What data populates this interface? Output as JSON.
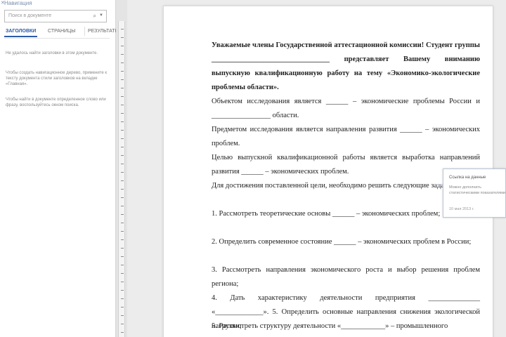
{
  "nav_pane": {
    "title": "Навигация",
    "search_placeholder": "Поиск в документе",
    "tabs": [
      {
        "label": "ЗАГОЛОВКИ",
        "active": true
      },
      {
        "label": "СТРАНИЦЫ",
        "active": false
      },
      {
        "label": "РЕЗУЛЬТАТЫ",
        "active": false
      }
    ],
    "help": [
      "Не удалось найти заголовки в этом документе.",
      "Чтобы создать навигационное дерево, примените к тексту документа стили заголовков на вкладке «Главная».",
      "Чтобы найти в документе определенное слово или фразу, воспользуйтесь окном поиска."
    ]
  },
  "document": {
    "paragraphs": [
      {
        "text": "Уважаемые члены Государственной аттестационной комиссии! Студент группы ________________________________ представляет Вашему вниманию выпускную квалификационную работу на тему «Экономико-экологические проблемы области».",
        "bold": true
      },
      {
        "text": "Объектом исследования является ______ – экономические проблемы России и ________________ области.",
        "bold": false
      },
      {
        "text": "Предметом исследования является направления развития ______ – экономических проблем.",
        "bold": false
      },
      {
        "text": "Целью выпускной квалификационной работы является выработка направлений развития ______ – экономических проблем.",
        "bold": false
      },
      {
        "text": "Для достижения поставленной цели, необходимо решить следующие задачи:",
        "bold": false
      },
      {
        "text": "1. Рассмотреть теоретические основы ______ – экономических проблем;",
        "bold": false
      },
      {
        "text": "2. Определить современное состояние ______ – экономических проблем в России;",
        "bold": false
      },
      {
        "text": "3. Рассмотреть направления экономического роста и выбор решения проблем региона;",
        "bold": false
      },
      {
        "text": "4. Дать характеристику деятельности предприятия ______________ «_____________». 5. Определить основные направления снижения экологической нагрузки;",
        "bold": false
      },
      {
        "text": "5. Рассмотреть структуру деятельности «____________» – промышленного",
        "bold": false
      }
    ]
  },
  "comment": {
    "author": "Ссылка на данные",
    "text": "Можно дополнить статистическими показателями",
    "date": "10 мая 2013 г."
  },
  "colors": {
    "accent": "#2a5aa8",
    "page": "#ffffff",
    "workspace": "#ececec"
  }
}
